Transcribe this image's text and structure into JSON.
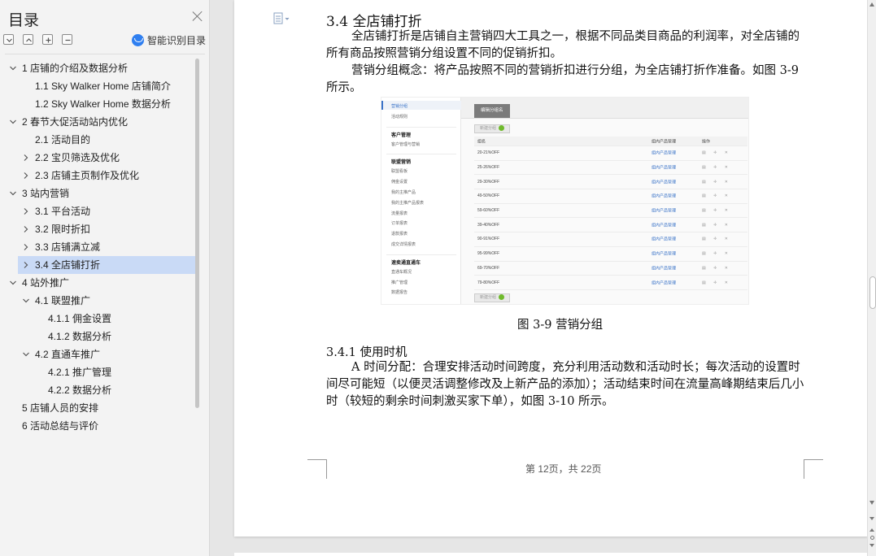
{
  "toc": {
    "title": "目录",
    "smart_toc_label": "智能识别目录",
    "toolbar": [
      "collapse-all",
      "collapse",
      "expand",
      "minus"
    ],
    "items": [
      {
        "label": "1 店铺的介绍及数据分析",
        "level": 1,
        "chevron": "down",
        "selected": false
      },
      {
        "label": "1.1 Sky Walker Home 店铺简介",
        "level": 2,
        "chevron": "",
        "selected": false
      },
      {
        "label": "1.2 Sky Walker Home 数据分析",
        "level": 2,
        "chevron": "",
        "selected": false
      },
      {
        "label": "2 春节大促活动站内优化",
        "level": 1,
        "chevron": "down",
        "selected": false
      },
      {
        "label": "2.1 活动目的",
        "level": 2,
        "chevron": "",
        "selected": false
      },
      {
        "label": "2.2 宝贝筛选及优化",
        "level": 2,
        "chevron": "right",
        "selected": false
      },
      {
        "label": "2.3 店铺主页制作及优化",
        "level": 2,
        "chevron": "right",
        "selected": false
      },
      {
        "label": "3 站内营销",
        "level": 1,
        "chevron": "down",
        "selected": false
      },
      {
        "label": "3.1 平台活动",
        "level": 2,
        "chevron": "right",
        "selected": false
      },
      {
        "label": "3.2 限时折扣",
        "level": 2,
        "chevron": "right",
        "selected": false
      },
      {
        "label": "3.3 店铺满立减",
        "level": 2,
        "chevron": "right",
        "selected": false
      },
      {
        "label": "3.4 全店铺打折",
        "level": 2,
        "chevron": "right",
        "selected": true
      },
      {
        "label": "4 站外推广",
        "level": 1,
        "chevron": "down",
        "selected": false
      },
      {
        "label": "4.1 联盟推广",
        "level": 2,
        "chevron": "down",
        "selected": false
      },
      {
        "label": "4.1.1  佣金设置",
        "level": 3,
        "chevron": "",
        "selected": false
      },
      {
        "label": "4.1.2  数据分析",
        "level": 3,
        "chevron": "",
        "selected": false
      },
      {
        "label": "4.2 直通车推广",
        "level": 2,
        "chevron": "down",
        "selected": false
      },
      {
        "label": "4.2.1 推广管理",
        "level": 3,
        "chevron": "",
        "selected": false
      },
      {
        "label": "4.2.2 数据分析",
        "level": 3,
        "chevron": "",
        "selected": false
      },
      {
        "label": "5 店铺人员的安排",
        "level": 1,
        "chevron": "",
        "selected": false
      },
      {
        "label": "6 活动总结与评价",
        "level": 1,
        "chevron": "",
        "selected": false
      }
    ]
  },
  "document": {
    "heading": "3.4 全店铺打折",
    "paragraph1": "全店铺打折是店铺自主营销四大工具之一，根据不同品类目商品的利润率，对全店铺的所有商品按照营销分组设置不同的促销折扣。",
    "paragraph2": "营销分组概念：将产品按照不同的营销折扣进行分组，为全店铺打折作准备。如图 3-9 所示。",
    "figure_caption": "图 3-9 营销分组",
    "subheading": "3.4.1 使用时机",
    "paragraph3": "A 时间分配：合理安排活动时间跨度，充分利用活动数和活动时长；每次活动的设置时间尽可能短（以便灵活调整修改及上新产品的添加）；活动结束时间在流量高峰期结束后几小时（较短的剩余时间刺激买家下单），如图 3-10 所示。",
    "page_number": "第 12页，共 22页"
  },
  "embedded_screenshot": {
    "sidebar": {
      "items": [
        {
          "label": "营销分组",
          "head": false,
          "active": true
        },
        {
          "label": "活动规则",
          "head": false,
          "active": false
        },
        {
          "label": "客户管理",
          "head": true,
          "active": false
        },
        {
          "label": "客户管理与营销",
          "head": false,
          "active": false
        },
        {
          "label": "联盟营销",
          "head": true,
          "active": false
        },
        {
          "label": "联盟看板",
          "head": false,
          "active": false
        },
        {
          "label": "佣金设置",
          "head": false,
          "active": false
        },
        {
          "label": "我的主推产品",
          "head": false,
          "active": false
        },
        {
          "label": "我的主推产品报表",
          "head": false,
          "active": false
        },
        {
          "label": "流量报表",
          "head": false,
          "active": false
        },
        {
          "label": "订单报表",
          "head": false,
          "active": false
        },
        {
          "label": "退款报表",
          "head": false,
          "active": false
        },
        {
          "label": "成交详情报表",
          "head": false,
          "active": false
        },
        {
          "label": "速卖通直通车",
          "head": true,
          "active": false
        },
        {
          "label": "直通车概况",
          "head": false,
          "active": false
        },
        {
          "label": "推广管理",
          "head": false,
          "active": false
        },
        {
          "label": "数据报告",
          "head": false,
          "active": false
        }
      ]
    },
    "tab": "编辑分组名",
    "add_button": "新建分组",
    "columns": [
      "组名",
      "组内产品管理",
      "操作"
    ],
    "rows": [
      {
        "name": "20-21%OFF",
        "link": "组内产品管理"
      },
      {
        "name": "25-26%OFF",
        "link": "组内产品管理"
      },
      {
        "name": "29-30%OFF",
        "link": "组内产品管理"
      },
      {
        "name": "49-50%OFF",
        "link": "组内产品管理"
      },
      {
        "name": "59-60%OFF",
        "link": "组内产品管理"
      },
      {
        "name": "39-40%OFF",
        "link": "组内产品管理"
      },
      {
        "name": "90-91%OFF",
        "link": "组内产品管理"
      },
      {
        "name": "95-99%OFF",
        "link": "组内产品管理"
      },
      {
        "name": "69-70%OFF",
        "link": "组内产品管理"
      },
      {
        "name": "79-80%OFF",
        "link": "组内产品管理"
      }
    ],
    "ops": "▤ ✛ ✕"
  }
}
